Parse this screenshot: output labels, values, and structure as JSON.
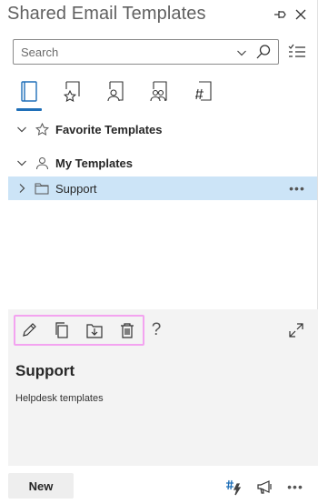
{
  "header": {
    "title": "Shared Email Templates",
    "icons": {
      "pin": "pin-icon",
      "close": "close-icon"
    }
  },
  "search": {
    "placeholder": "Search",
    "value": "",
    "icons": {
      "dropdown": "chevron-down-icon",
      "search": "search-icon",
      "filter": "checklist-icon"
    }
  },
  "tabs": [
    {
      "name": "all-templates",
      "icon": "book-icon",
      "active": true
    },
    {
      "name": "favorite-templates",
      "icon": "star-page-icon",
      "active": false
    },
    {
      "name": "my-templates",
      "icon": "user-page-icon",
      "active": false
    },
    {
      "name": "team-templates",
      "icon": "team-page-icon",
      "active": false
    },
    {
      "name": "hashtag-templates",
      "icon": "hash-page-icon",
      "active": false
    }
  ],
  "tree": {
    "favorite": {
      "label": "Favorite Templates",
      "icon": "star-icon",
      "expanded": true
    },
    "my": {
      "label": "My Templates",
      "icon": "person-icon",
      "expanded": true
    },
    "support": {
      "label": "Support",
      "icon": "folder-icon",
      "expanded": false,
      "selected": true,
      "more": "•••"
    }
  },
  "preview": {
    "title": "Support",
    "description": "Helpdesk templates",
    "help": "?",
    "toolbar": [
      "edit-icon",
      "copy-icon",
      "move-icon",
      "delete-icon"
    ]
  },
  "footer": {
    "new_label": "New",
    "more": "•••",
    "icons": {
      "macro": "hash-lightning-icon",
      "announce": "megaphone-icon"
    }
  },
  "colors": {
    "accent": "#1f6fb8",
    "selected_row": "#cce4f7",
    "preview_bg": "#f3f3f3",
    "toolbar_highlight": "#f3a3f0"
  }
}
